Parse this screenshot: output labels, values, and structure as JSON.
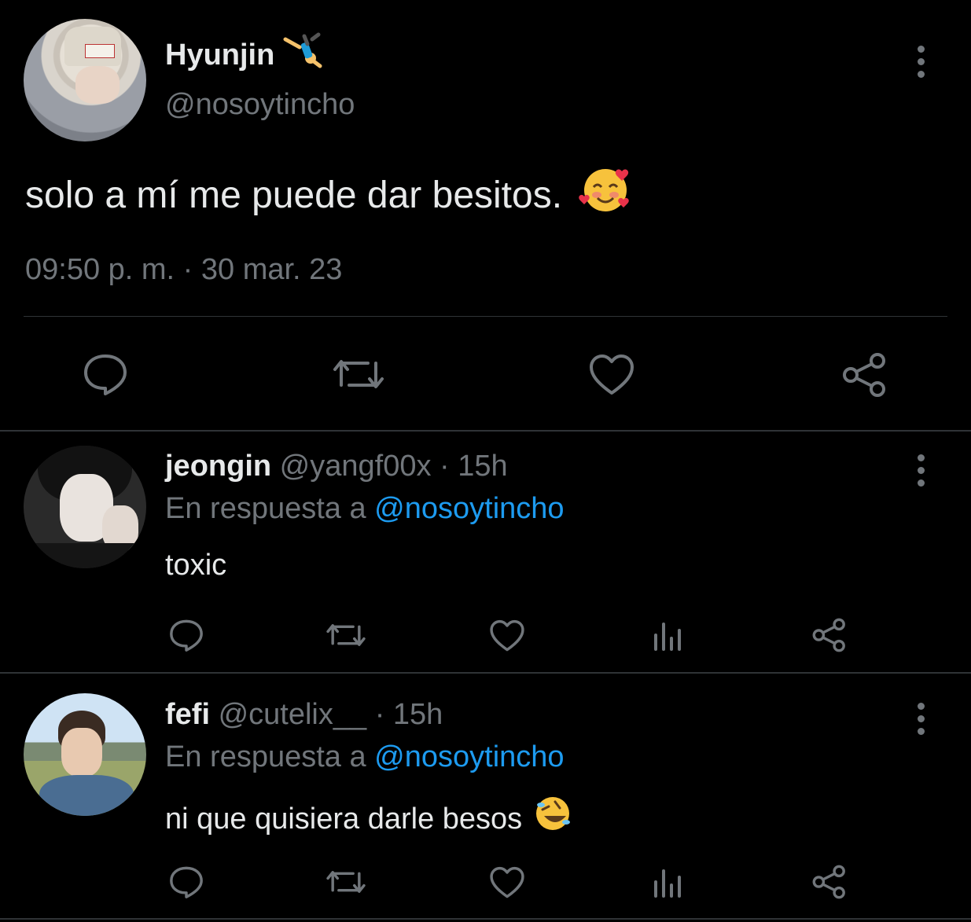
{
  "main_tweet": {
    "display_name": "Hyunjin",
    "handle": "@nosoytincho",
    "text": "solo a mí me puede dar besitos.",
    "timestamp": "09:50 p. m. · 30 mar. 23",
    "name_emoji": "person-cartwheeling",
    "text_emoji": "smiling-face-with-hearts"
  },
  "replies": [
    {
      "display_name": "jeongin",
      "handle": "@yangf00x",
      "time": "· 15h",
      "reply_prefix": "En respuesta a",
      "reply_to": "@nosoytincho",
      "text": "toxic"
    },
    {
      "display_name": "fefi",
      "handle": "@cutelix__",
      "time": "· 15h",
      "reply_prefix": "En respuesta a",
      "reply_to": "@nosoytincho",
      "text": "ni que quisiera darle besos",
      "text_emoji": "rolling-on-the-floor-laughing"
    }
  ],
  "colors": {
    "background": "#000000",
    "text": "#e7e9ea",
    "muted": "#71767b",
    "link": "#1d9bf0",
    "divider": "#2f3336"
  }
}
